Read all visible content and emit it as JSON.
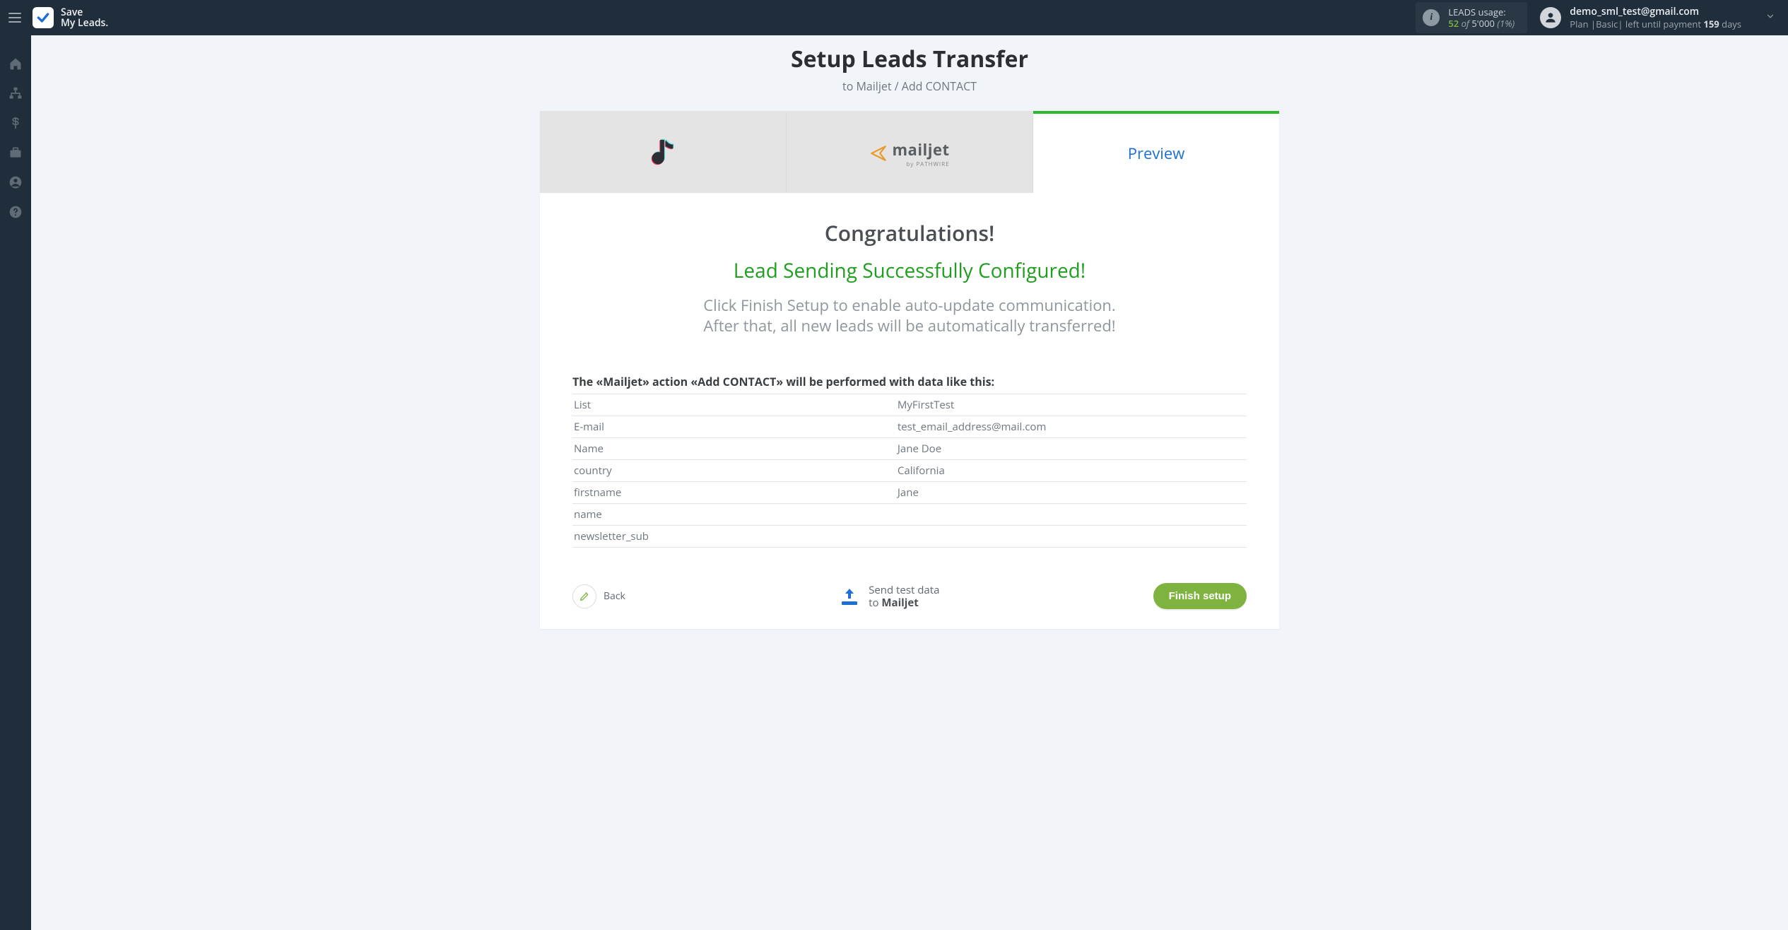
{
  "brand": {
    "line1": "Save",
    "line2": "My Leads."
  },
  "usage": {
    "label": "LEADS usage:",
    "used": "52",
    "of": "of",
    "total": "5'000",
    "pct": "(1%)"
  },
  "user": {
    "email": "demo_sml_test@gmail.com",
    "plan_prefix": "Plan |Basic| left until payment ",
    "days": "159",
    "days_suffix": " days"
  },
  "page": {
    "title": "Setup Leads Transfer",
    "subtitle": "to Mailjet / Add CONTACT"
  },
  "tabs": {
    "preview": "Preview",
    "mailjet_word": "mailjet",
    "mailjet_sub": "by PATHWIRE"
  },
  "congrats": {
    "h": "Congratulations!",
    "green": "Lead Sending Successfully Configured!",
    "gray1": "Click Finish Setup to enable auto-update communication.",
    "gray2": "After that, all new leads will be automatically transferred!"
  },
  "table": {
    "caption": "The «Mailjet» action «Add CONTACT» will be performed with data like this:",
    "rows": [
      {
        "k": "List",
        "v": "MyFirstTest"
      },
      {
        "k": "E-mail",
        "v": "test_email_address@mail.com"
      },
      {
        "k": "Name",
        "v": "Jane Doe"
      },
      {
        "k": "country",
        "v": "California"
      },
      {
        "k": "firstname",
        "v": "Jane"
      },
      {
        "k": "name",
        "v": ""
      },
      {
        "k": "newsletter_sub",
        "v": ""
      }
    ]
  },
  "actions": {
    "back": "Back",
    "send_test_line1": "Send test data",
    "send_test_to": "to ",
    "send_test_target": "Mailjet",
    "finish": "Finish setup"
  }
}
